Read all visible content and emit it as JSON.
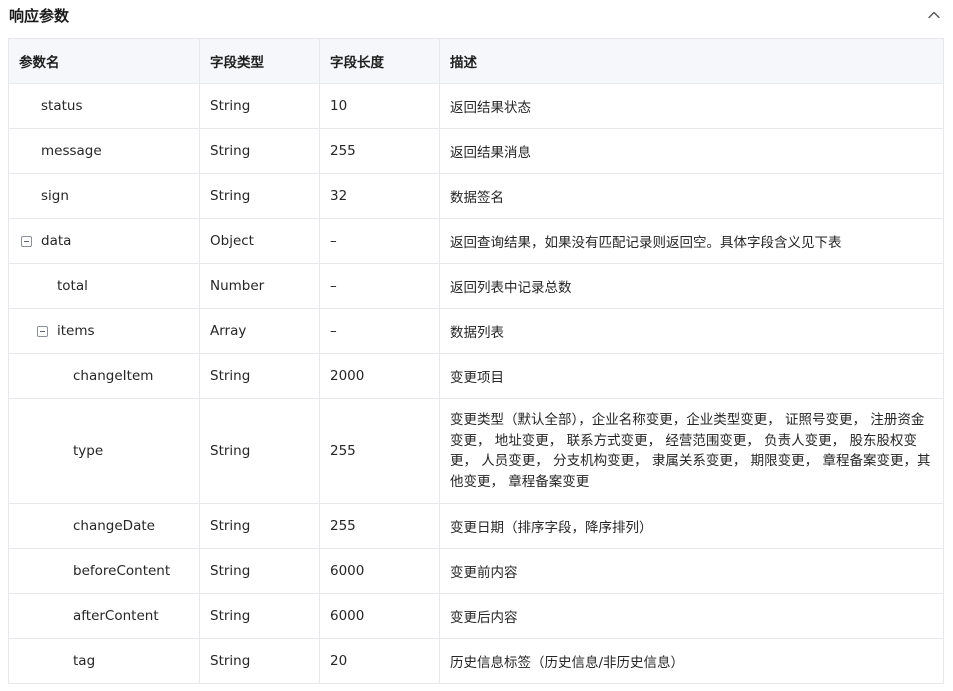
{
  "section": {
    "title": "响应参数"
  },
  "table": {
    "headers": [
      "参数名",
      "字段类型",
      "字段长度",
      "描述"
    ],
    "rows": [
      {
        "name": "status",
        "type": "String",
        "length": "10",
        "desc": "返回结果状态",
        "level": 1,
        "toggle": false
      },
      {
        "name": "message",
        "type": "String",
        "length": "255",
        "desc": "返回结果消息",
        "level": 1,
        "toggle": false
      },
      {
        "name": "sign",
        "type": "String",
        "length": "32",
        "desc": "数据签名",
        "level": 1,
        "toggle": false
      },
      {
        "name": "data",
        "type": "Object",
        "length": "–",
        "desc": "返回查询结果，如果没有匹配记录则返回空。具体字段含义见下表",
        "level": 0,
        "toggle": true
      },
      {
        "name": "total",
        "type": "Number",
        "length": "–",
        "desc": "返回列表中记录总数",
        "level": 2,
        "toggle": false
      },
      {
        "name": "items",
        "type": "Array",
        "length": "–",
        "desc": "数据列表",
        "level": 1,
        "toggle": true
      },
      {
        "name": "changeItem",
        "type": "String",
        "length": "2000",
        "desc": "变更项目",
        "level": 3,
        "toggle": false
      },
      {
        "name": "type",
        "type": "String",
        "length": "255",
        "desc": "变更类型（默认全部），企业名称变更，企业类型变更， 证照号变更， 注册资金变更， 地址变更， 联系方式变更， 经营范围变更， 负责人变更， 股东股权变更， 人员变更， 分支机构变更， 隶属关系变更， 期限变更， 章程备案变更，其他变更， 章程备案变更",
        "level": 3,
        "toggle": false,
        "tall": true
      },
      {
        "name": "changeDate",
        "type": "String",
        "length": "255",
        "desc": "变更日期（排序字段，降序排列）",
        "level": 3,
        "toggle": false
      },
      {
        "name": "beforeContent",
        "type": "String",
        "length": "6000",
        "desc": "变更前内容",
        "level": 3,
        "toggle": false
      },
      {
        "name": "afterContent",
        "type": "String",
        "length": "6000",
        "desc": "变更后内容",
        "level": 3,
        "toggle": false
      },
      {
        "name": "tag",
        "type": "String",
        "length": "20",
        "desc": "历史信息标签（历史信息/非历史信息）",
        "level": 3,
        "toggle": false
      }
    ]
  }
}
